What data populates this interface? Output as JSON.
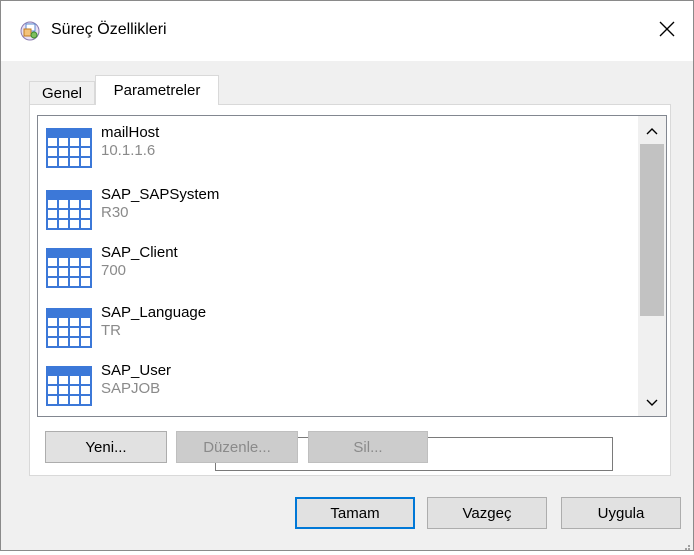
{
  "window": {
    "title": "Süreç Özellikleri",
    "app_icon": "process-properties-icon",
    "close_icon": "close-icon"
  },
  "tabs": [
    {
      "label": "Genel",
      "active": false
    },
    {
      "label": "Parametreler",
      "active": true
    }
  ],
  "parameters": [
    {
      "name": "mailHost",
      "value": "10.1.1.6"
    },
    {
      "name": "SAP_SAPSystem",
      "value": "R30"
    },
    {
      "name": "SAP_Client",
      "value": "700"
    },
    {
      "name": "SAP_Language",
      "value": "TR"
    },
    {
      "name": "SAP_User",
      "value": "SAPJOB"
    }
  ],
  "list_buttons": {
    "new_label": "Yeni...",
    "edit_label": "Düzenle...",
    "delete_label": "Sil..."
  },
  "dialog_buttons": {
    "ok_label": "Tamam",
    "cancel_label": "Vazgeç",
    "apply_label": "Uygula"
  },
  "colors": {
    "accent": "#0078d7",
    "disabled_text": "#8a8a8a",
    "value_text": "#8a8a8a"
  }
}
